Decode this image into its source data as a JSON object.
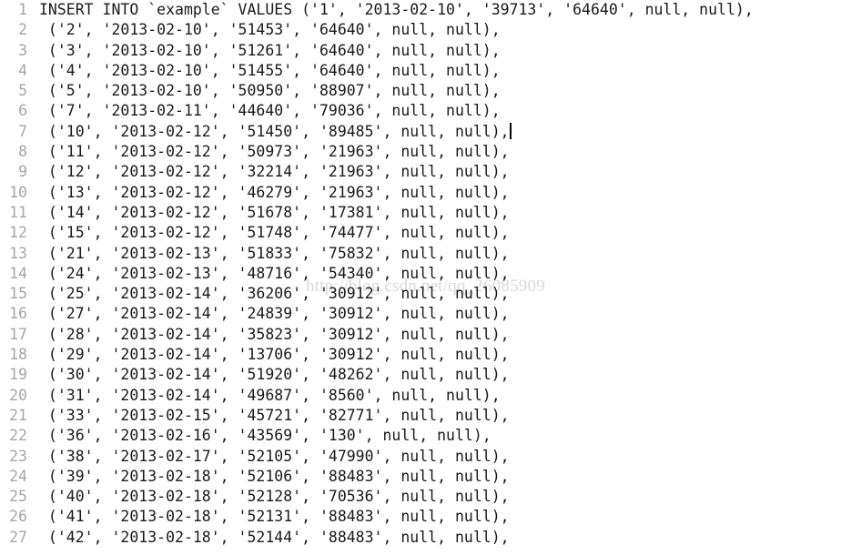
{
  "editor": {
    "language": "sql",
    "background_color": "#ffffff",
    "text_color": "#1a1a1a",
    "gutter_color": "#a6a6a6",
    "caret_color": "#000000",
    "caret_line": 7,
    "watermark": "http://blog.csdn.net/qq_26085909",
    "watermark_color": "#d9d9d9",
    "lines": [
      {
        "number": "1",
        "text": "INSERT INTO `example` VALUES ('1', '2013-02-10', '39713', '64640', null, null),"
      },
      {
        "number": "2",
        "text": " ('2', '2013-02-10', '51453', '64640', null, null),"
      },
      {
        "number": "3",
        "text": " ('3', '2013-02-10', '51261', '64640', null, null),"
      },
      {
        "number": "4",
        "text": " ('4', '2013-02-10', '51455', '64640', null, null),"
      },
      {
        "number": "5",
        "text": " ('5', '2013-02-10', '50950', '88907', null, null),"
      },
      {
        "number": "6",
        "text": " ('7', '2013-02-11', '44640', '79036', null, null),"
      },
      {
        "number": "7",
        "text": " ('10', '2013-02-12', '51450', '89485', null, null),"
      },
      {
        "number": "8",
        "text": " ('11', '2013-02-12', '50973', '21963', null, null),"
      },
      {
        "number": "9",
        "text": " ('12', '2013-02-12', '32214', '21963', null, null),"
      },
      {
        "number": "10",
        "text": " ('13', '2013-02-12', '46279', '21963', null, null),"
      },
      {
        "number": "11",
        "text": " ('14', '2013-02-12', '51678', '17381', null, null),"
      },
      {
        "number": "12",
        "text": " ('15', '2013-02-12', '51748', '74477', null, null),"
      },
      {
        "number": "13",
        "text": " ('21', '2013-02-13', '51833', '75832', null, null),"
      },
      {
        "number": "14",
        "text": " ('24', '2013-02-13', '48716', '54340', null, null),"
      },
      {
        "number": "15",
        "text": " ('25', '2013-02-14', '36206', '30912', null, null),"
      },
      {
        "number": "16",
        "text": " ('27', '2013-02-14', '24839', '30912', null, null),"
      },
      {
        "number": "17",
        "text": " ('28', '2013-02-14', '35823', '30912', null, null),"
      },
      {
        "number": "18",
        "text": " ('29', '2013-02-14', '13706', '30912', null, null),"
      },
      {
        "number": "19",
        "text": " ('30', '2013-02-14', '51920', '48262', null, null),"
      },
      {
        "number": "20",
        "text": " ('31', '2013-02-14', '49687', '8560', null, null),"
      },
      {
        "number": "21",
        "text": " ('33', '2013-02-15', '45721', '82771', null, null),"
      },
      {
        "number": "22",
        "text": " ('36', '2013-02-16', '43569', '130', null, null),"
      },
      {
        "number": "23",
        "text": " ('38', '2013-02-17', '52105', '47990', null, null),"
      },
      {
        "number": "24",
        "text": " ('39', '2013-02-18', '52106', '88483', null, null),"
      },
      {
        "number": "25",
        "text": " ('40', '2013-02-18', '52128', '70536', null, null),"
      },
      {
        "number": "26",
        "text": " ('41', '2013-02-18', '52131', '88483', null, null),"
      },
      {
        "number": "27",
        "text": " ('42', '2013-02-18', '52144', '88483', null, null),"
      }
    ]
  }
}
